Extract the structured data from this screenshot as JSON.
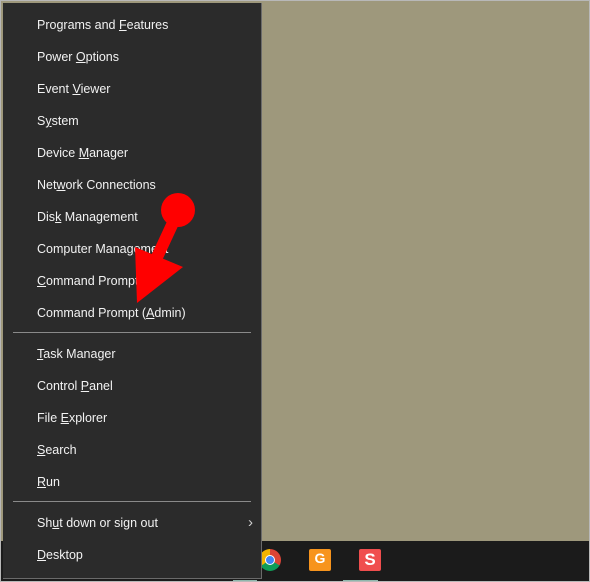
{
  "menu": {
    "items": [
      {
        "pre": "Programs and ",
        "key": "F",
        "post": "eatures"
      },
      {
        "pre": "Power ",
        "key": "O",
        "post": "ptions"
      },
      {
        "pre": "Event ",
        "key": "V",
        "post": "iewer"
      },
      {
        "pre": "S",
        "key": "y",
        "post": "stem"
      },
      {
        "pre": "Device ",
        "key": "M",
        "post": "anager"
      },
      {
        "pre": "Net",
        "key": "w",
        "post": "ork Connections"
      },
      {
        "pre": "Dis",
        "key": "k",
        "post": " Management"
      },
      {
        "pre": "Computer Mana",
        "key": "g",
        "post": "ement"
      },
      {
        "pre": "",
        "key": "C",
        "post": "ommand Prompt"
      },
      {
        "pre": "Command Prompt (",
        "key": "A",
        "post": "dmin)"
      },
      {
        "pre": "",
        "key": "T",
        "post": "ask Manager"
      },
      {
        "pre": "Control ",
        "key": "P",
        "post": "anel"
      },
      {
        "pre": "File ",
        "key": "E",
        "post": "xplorer"
      },
      {
        "pre": "",
        "key": "S",
        "post": "earch"
      },
      {
        "pre": "",
        "key": "R",
        "post": "un"
      },
      {
        "pre": "Sh",
        "key": "u",
        "post": "t down or sign out"
      },
      {
        "pre": "",
        "key": "D",
        "post": "esktop"
      }
    ]
  },
  "annotation": {
    "color": "#ff0000",
    "target": "Command Prompt (Admin)"
  },
  "taskbar": {
    "icons": [
      "chrome-icon",
      "foxit-pdf-icon",
      "smallpdf-icon"
    ]
  },
  "colors": {
    "desktop": "#9e987c",
    "menu": "#2b2b2b",
    "taskbar": "#1b1b1b"
  }
}
